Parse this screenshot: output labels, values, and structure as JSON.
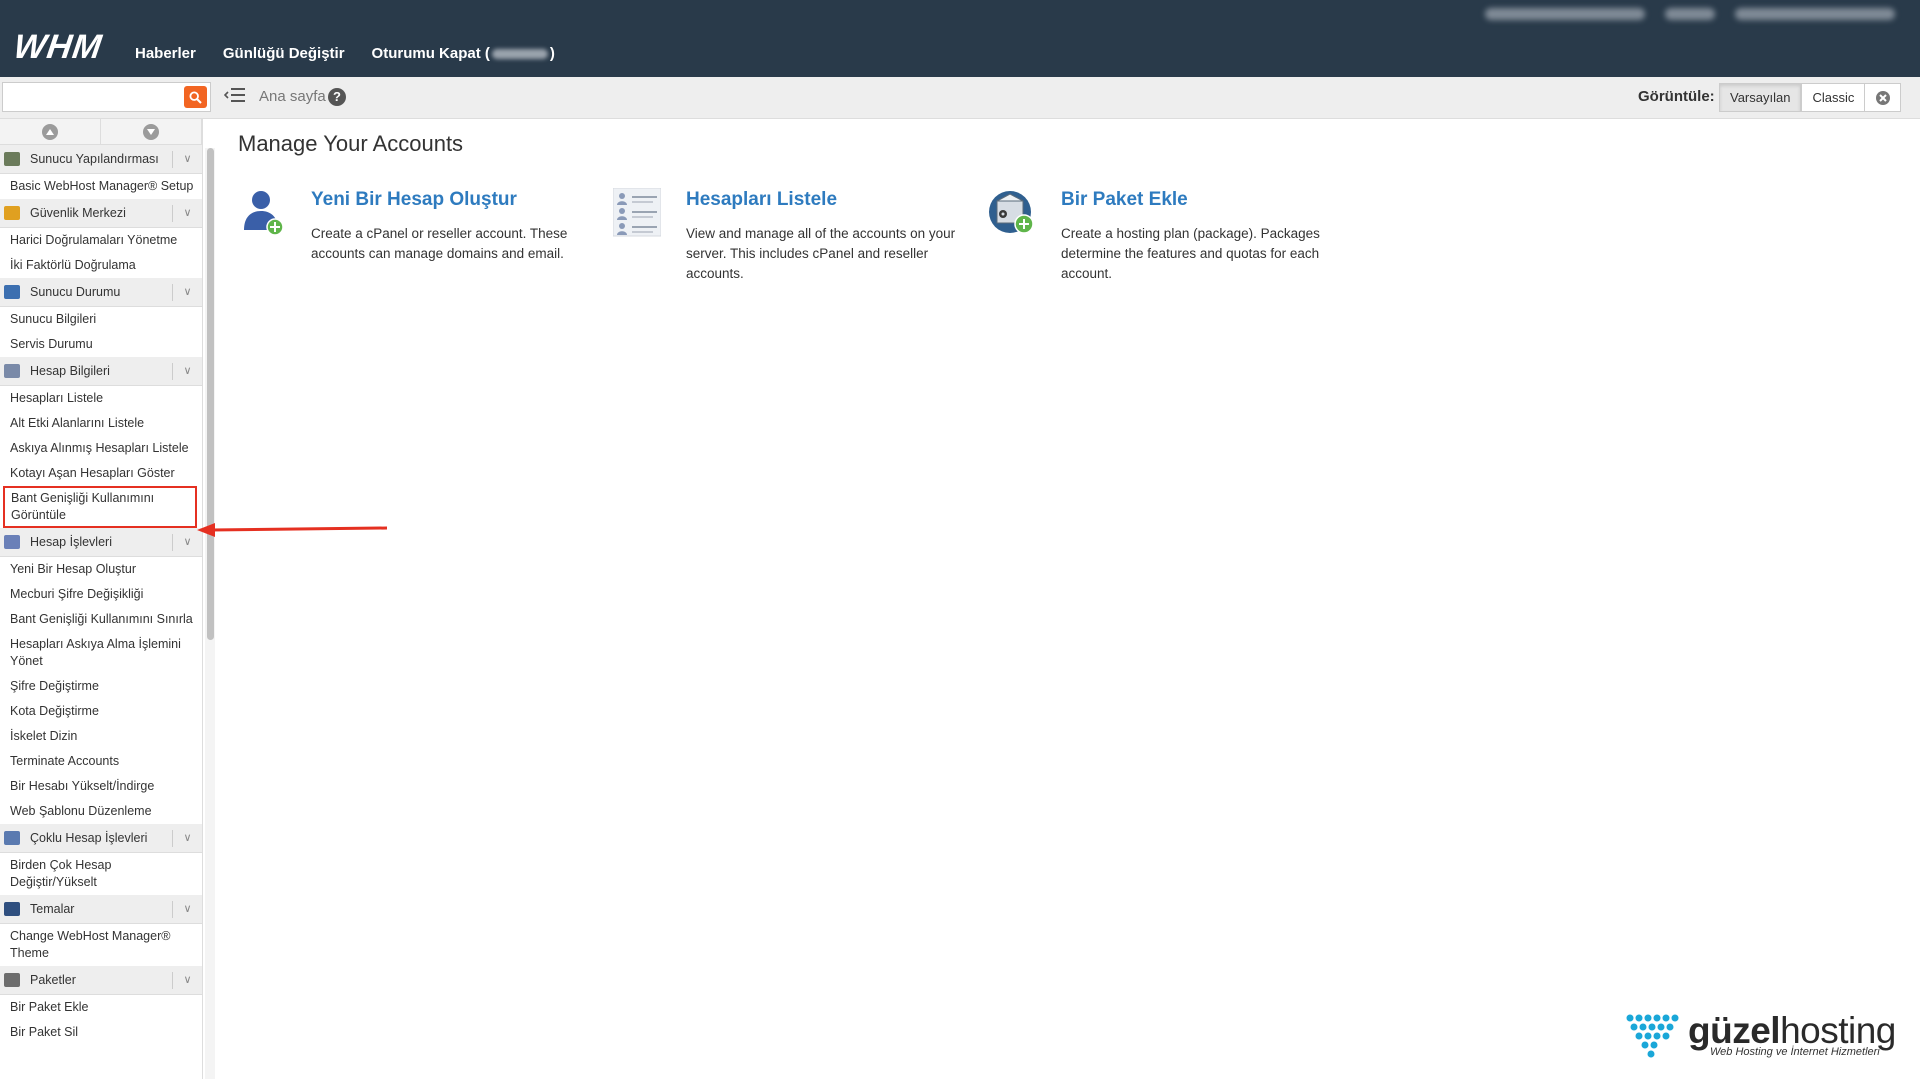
{
  "header": {
    "logo": "WHM",
    "nav": [
      "Haberler",
      "Günlüğü Değiştir"
    ],
    "logout_prefix": "Oturumu Kapat (",
    "logout_suffix": ")"
  },
  "toolbar": {
    "search_placeholder": "",
    "breadcrumb": "Ana sayfa",
    "help": "?",
    "view_label": "Görüntüle:",
    "view_default": "Varsayılan",
    "view_classic": "Classic"
  },
  "sidebar": {
    "sections": [
      {
        "label": "Sunucu Yapılandırması",
        "icon": "server-config-icon",
        "color": "#6b7b5b",
        "items": [
          "Basic WebHost Manager® Setup"
        ]
      },
      {
        "label": "Güvenlik Merkezi",
        "icon": "lock-icon",
        "color": "#e0a020",
        "items": [
          "Harici Doğrulamaları Yönetme",
          "İki Faktörlü Doğrulama"
        ]
      },
      {
        "label": "Sunucu Durumu",
        "icon": "server-status-icon",
        "color": "#3c6fb0",
        "items": [
          "Sunucu Bilgileri",
          "Servis Durumu"
        ]
      },
      {
        "label": "Hesap Bilgileri",
        "icon": "account-info-icon",
        "color": "#7a8aa8",
        "items": [
          "Hesapları Listele",
          "Alt Etki Alanlarını Listele",
          "Askıya Alınmış Hesapları Listele",
          "Kotayı Aşan Hesapları Göster",
          "Bant Genişliği Kullanımını Görüntüle"
        ]
      },
      {
        "label": "Hesap İşlevleri",
        "icon": "account-functions-icon",
        "color": "#6a80b8",
        "items": [
          "Yeni Bir Hesap Oluştur",
          "Mecburi Şifre Değişikliği",
          "Bant Genişliği Kullanımını Sınırla",
          "Hesapları Askıya Alma İşlemini Yönet",
          "Şifre Değiştirme",
          "Kota Değiştirme",
          "İskelet Dizin",
          "Terminate Accounts",
          "Bir Hesabı Yükselt/İndirge",
          "Web Şablonu Düzenleme"
        ]
      },
      {
        "label": "Çoklu Hesap İşlevleri",
        "icon": "multi-account-icon",
        "color": "#5a7ab0",
        "items": [
          "Birden Çok Hesap Değiştir/Yükselt"
        ]
      },
      {
        "label": "Temalar",
        "icon": "themes-icon",
        "color": "#2f4f7f",
        "items": [
          "Change WebHost Manager® Theme"
        ]
      },
      {
        "label": "Paketler",
        "icon": "packages-icon",
        "color": "#6d6d6d",
        "items": [
          "Bir Paket Ekle",
          "Bir Paket Sil"
        ]
      }
    ]
  },
  "main": {
    "title": "Manage Your Accounts",
    "cards": [
      {
        "title": "Yeni Bir Hesap Oluştur",
        "desc": "Create a cPanel or reseller account. These accounts can manage domains and email."
      },
      {
        "title": "Hesapları Listele",
        "desc": "View and manage all of the accounts on your server. This includes cPanel and reseller accounts."
      },
      {
        "title": "Bir Paket Ekle",
        "desc": "Create a hosting plan (package). Packages determine the features and quotas for each account."
      }
    ]
  },
  "brand": {
    "name_bold": "güzel",
    "name_rest": "hosting",
    "tagline": "Web Hosting ve İnternet Hizmetleri"
  },
  "colors": {
    "header_bg": "#293a4a",
    "link_blue": "#2e7bbf",
    "accent_orange": "#f26522",
    "highlight_red": "#e53021"
  }
}
